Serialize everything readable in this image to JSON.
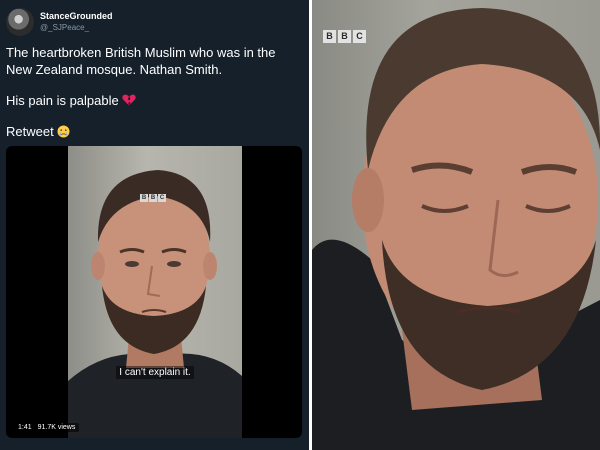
{
  "tweet": {
    "display_name": "StanceGrounded",
    "handle": "@_SJPeace_",
    "text_line1": "The heartbroken British Muslim who was in the New Zealand mosque. Nathan Smith.",
    "text_line2": "His pain is palpable",
    "text_line3": "Retweet",
    "emoji_line2": "broken-heart-icon",
    "emoji_line3": "crying-face-icon"
  },
  "video": {
    "logo": [
      "B",
      "B",
      "C"
    ],
    "subtitle": "I can't explain it.",
    "duration": "1:41",
    "views": "91.7K views"
  },
  "still": {
    "logo": [
      "B",
      "B",
      "C"
    ]
  },
  "colors": {
    "tweet_bg": "#15202b",
    "text": "#ffffff",
    "handle": "#8899a6",
    "heart": "#e0245e"
  }
}
